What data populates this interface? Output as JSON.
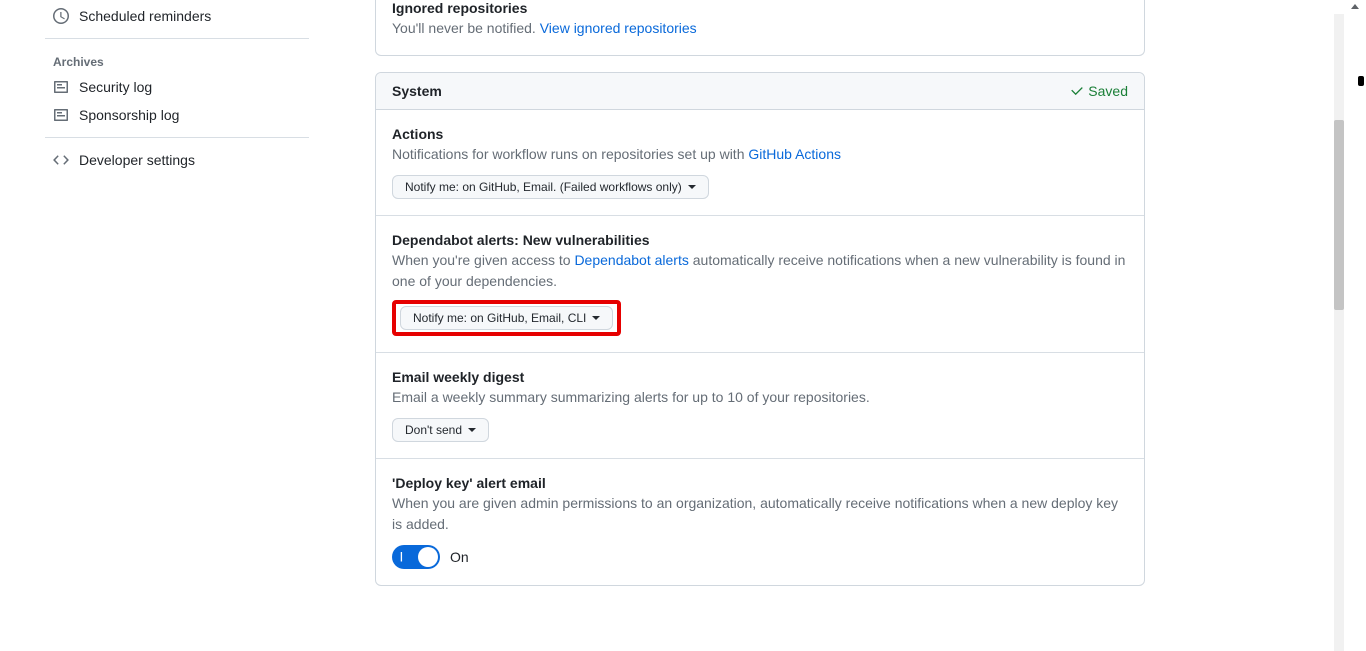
{
  "sidebar": {
    "scheduled_reminders": "Scheduled reminders",
    "archives_heading": "Archives",
    "security_log": "Security log",
    "sponsorship_log": "Sponsorship log",
    "developer_settings": "Developer settings"
  },
  "ignored": {
    "title": "Ignored repositories",
    "desc": "You'll never be notified.",
    "link": "View ignored repositories"
  },
  "system": {
    "header_title": "System",
    "saved_label": "Saved",
    "actions": {
      "title": "Actions",
      "desc": "Notifications for workflow runs on repositories set up with",
      "link": "GitHub Actions",
      "select_value": "Notify me: on GitHub, Email. (Failed workflows only)"
    },
    "dependabot": {
      "title": "Dependabot alerts: New vulnerabilities",
      "desc_pre": "When you're given access to",
      "link": "Dependabot alerts",
      "desc_post": "automatically receive notifications when a new vulnerability is found in one of your dependencies.",
      "select_value": "Notify me: on GitHub, Email, CLI"
    },
    "digest": {
      "title": "Email weekly digest",
      "desc": "Email a weekly summary summarizing alerts for up to 10 of your repositories.",
      "select_value": "Don't send"
    },
    "deploykey": {
      "title": "'Deploy key' alert email",
      "desc": "When you are given admin permissions to an organization, automatically receive notifications when a new deploy key is added.",
      "toggle_label": "On"
    }
  }
}
